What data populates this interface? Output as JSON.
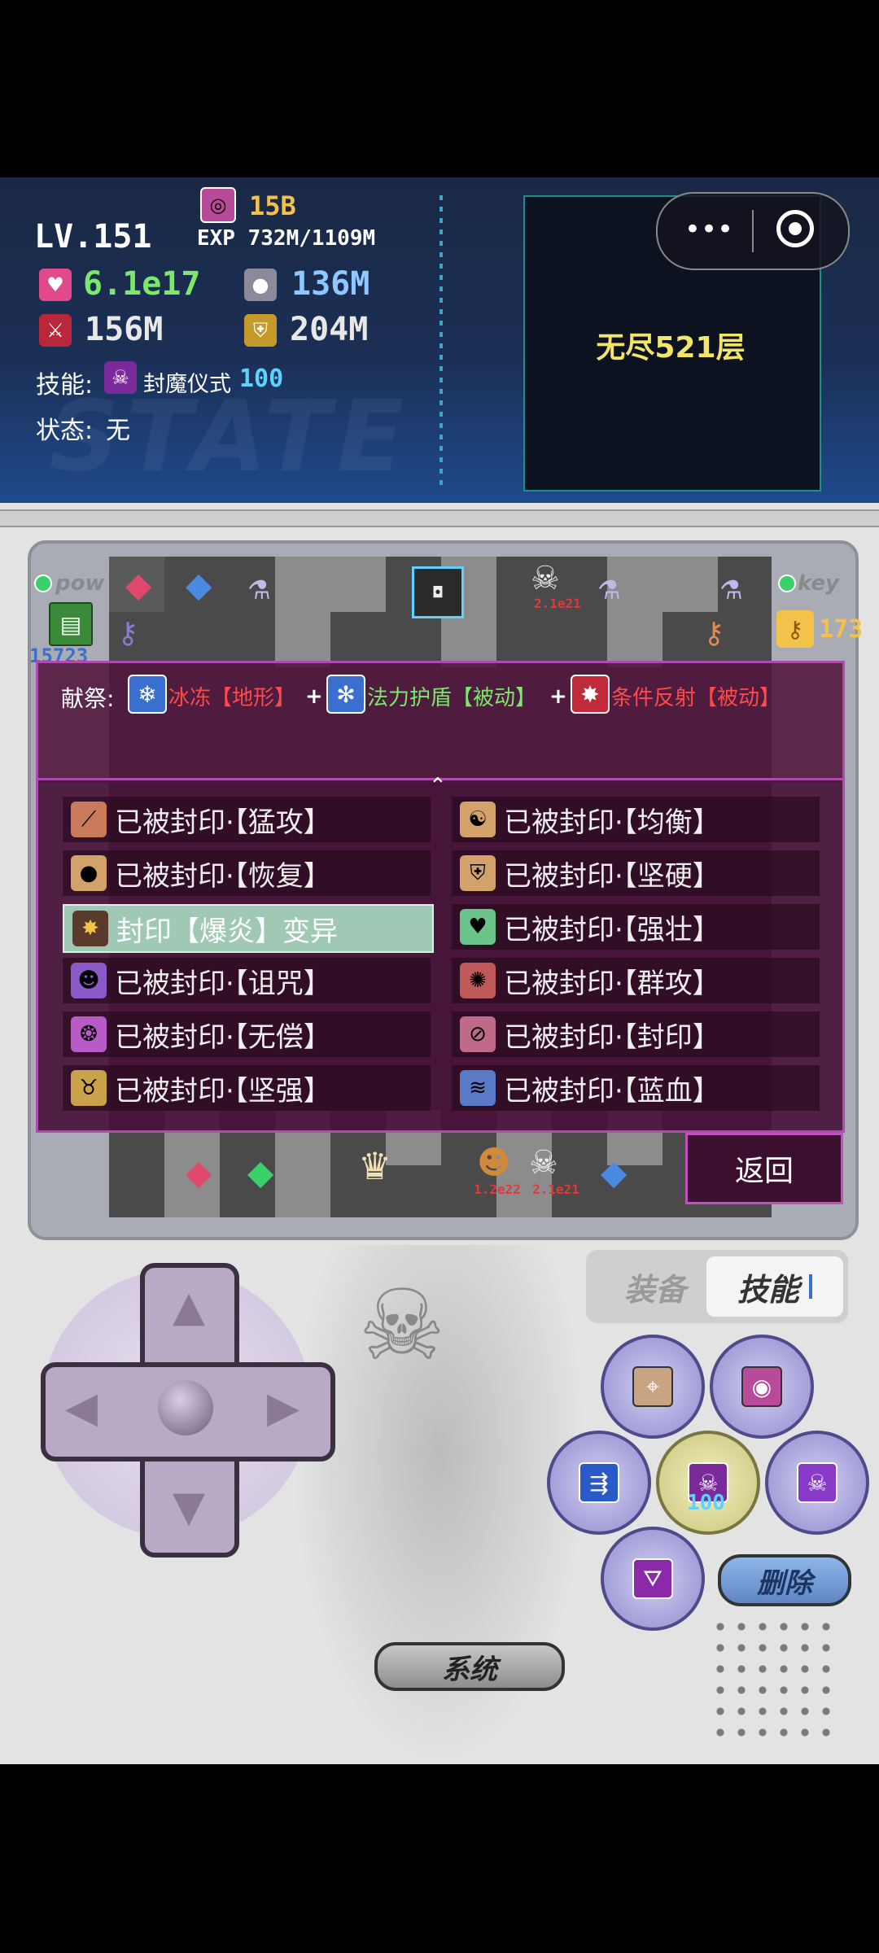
{
  "stats": {
    "level": "LV.151",
    "exp": "EXP 732M/1109M",
    "gem_count": "15B",
    "hp": "6.1e17",
    "mp": "136M",
    "atk": "156M",
    "def": "204M",
    "skill_label": "技能:",
    "skill_name": "封魔仪式",
    "skill_value": "100",
    "state_label": "状态:",
    "state_value": "无",
    "watermark": "STATE"
  },
  "map": {
    "endless_floor": "无尽521层"
  },
  "side": {
    "pow_label": "pow",
    "key_label": "key",
    "yellow_keys": "173",
    "left_partial": "15723",
    "monster_label_1": "2.1e21",
    "monster_label_2": "1.2e22",
    "monster_label_3": "2.1e21"
  },
  "tribute": {
    "label": "献祭:",
    "items": [
      {
        "name": "冰冻【地形】"
      },
      {
        "name": "法力护盾【被动】"
      },
      {
        "name": "条件反射【被动】"
      }
    ],
    "plus": "+"
  },
  "skills": [
    {
      "text": "已被封印·【猛攻】",
      "icon": "claw-icon"
    },
    {
      "text": "已被封印·【均衡】",
      "icon": "balance-icon"
    },
    {
      "text": "已被封印·【恢复】",
      "icon": "apple-icon"
    },
    {
      "text": "已被封印·【坚硬】",
      "icon": "shield-icon"
    },
    {
      "text": "封印【爆炎】变异",
      "icon": "explosion-icon"
    },
    {
      "text": "已被封印·【强壮】",
      "icon": "heart-icon"
    },
    {
      "text": "已被封印·【诅咒】",
      "icon": "demon-icon"
    },
    {
      "text": "已被封印·【群攻】",
      "icon": "swirl-icon"
    },
    {
      "text": "已被封印·【无偿】",
      "icon": "rune-icon"
    },
    {
      "text": "已被封印·【封印】",
      "icon": "forbid-icon"
    },
    {
      "text": "已被封印·【坚强】",
      "icon": "horns-icon"
    },
    {
      "text": "已被封印·【蓝血】",
      "icon": "wave-icon"
    }
  ],
  "buttons": {
    "back": "返回",
    "equip_tab": "装备",
    "skill_tab": "技能",
    "delete": "删除",
    "system": "系统",
    "skill_slot_value": "100"
  },
  "colors": {
    "hp": "#7be86a",
    "mp": "#8fc7ff",
    "stat_white": "#e8e8e8",
    "gold": "#f3c24a",
    "tribute_red": "#ff4a4a",
    "tribute_green": "#7be86a",
    "cyan": "#5fd1ff"
  }
}
